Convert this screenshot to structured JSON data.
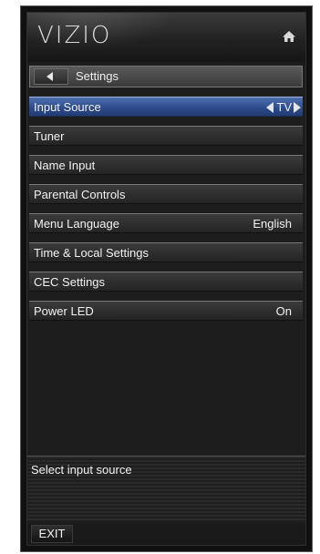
{
  "brand": {
    "logo_text": "VIZIO"
  },
  "header": {
    "home_icon": "home-icon"
  },
  "breadcrumb": {
    "back_icon": "chevron-left-icon",
    "label": "Settings"
  },
  "menu": {
    "items": [
      {
        "label": "Input Source",
        "value": "TV",
        "selected": true,
        "type": "selector"
      },
      {
        "label": "Tuner",
        "value": "",
        "selected": false
      },
      {
        "label": "Name Input",
        "value": "",
        "selected": false
      },
      {
        "label": "Parental Controls",
        "value": "",
        "selected": false
      },
      {
        "label": "Menu Language",
        "value": "English",
        "selected": false
      },
      {
        "label": "Time & Local Settings",
        "value": "",
        "selected": false
      },
      {
        "label": "CEC Settings",
        "value": "",
        "selected": false
      },
      {
        "label": "Power LED",
        "value": "On",
        "selected": false
      }
    ]
  },
  "help": {
    "text": "Select input source"
  },
  "footer": {
    "exit_label": "EXIT"
  },
  "colors": {
    "selected_bg": "#2c4a8a",
    "panel_bg": "#1d1d1d",
    "text": "#f2f2f2"
  }
}
